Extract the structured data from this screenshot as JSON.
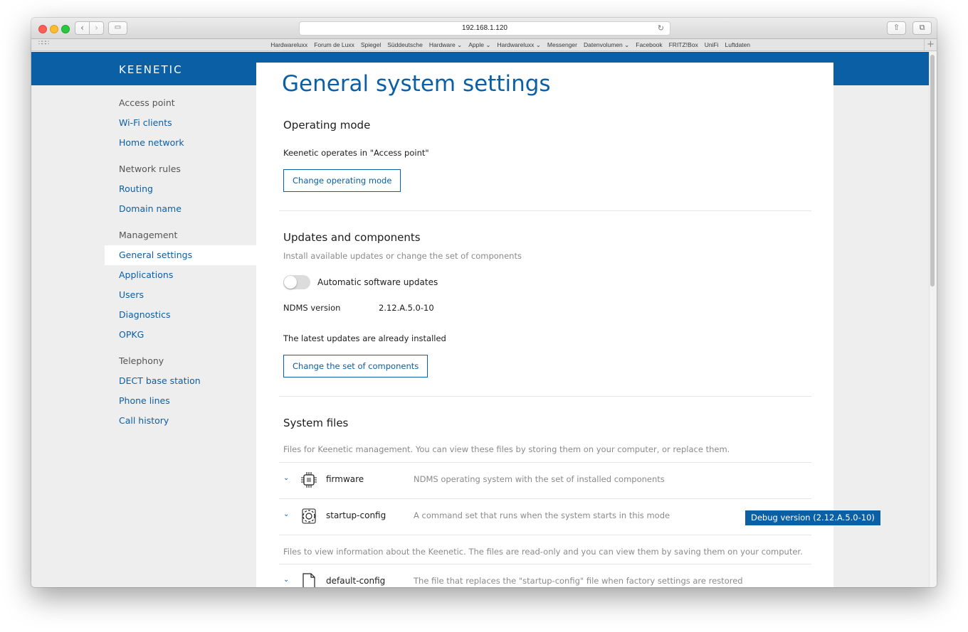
{
  "browser": {
    "address": "192.168.1.120",
    "favorites": [
      "Hardwareluxx",
      "Forum de Luxx",
      "Spiegel",
      "Süddeutsche",
      "Hardware ⌄",
      "Apple ⌄",
      "Hardwareluxx ⌄",
      "Messenger",
      "Datenvolumen ⌄",
      "Facebook",
      "FRITZ!Box",
      "UniFi",
      "Luftdaten"
    ]
  },
  "brand": {
    "logo": "KEENETIC",
    "accent": "#0b5fa5"
  },
  "sidebar": {
    "sections": [
      {
        "heading": "Access point",
        "items": [
          "Wi-Fi clients",
          "Home network"
        ]
      },
      {
        "heading": "Network rules",
        "items": [
          "Routing",
          "Domain name"
        ]
      },
      {
        "heading": "Management",
        "items": [
          "General settings",
          "Applications",
          "Users",
          "Diagnostics",
          "OPKG"
        ]
      },
      {
        "heading": "Telephony",
        "items": [
          "DECT base station",
          "Phone lines",
          "Call history"
        ]
      }
    ],
    "active": "General settings"
  },
  "main": {
    "title": "General system settings",
    "operating_mode": {
      "heading": "Operating mode",
      "text": "Keenetic operates in \"Access point\"",
      "button": "Change operating mode"
    },
    "updates": {
      "heading": "Updates and components",
      "subtitle": "Install available updates or change the set of components",
      "toggle_label": "Automatic software updates",
      "toggle_on": false,
      "version_label": "NDMS version",
      "version_value": "2.12.A.5.0-10",
      "status": "The latest updates are already installed",
      "button": "Change the set of components"
    },
    "system_files": {
      "heading": "System files",
      "subtitle": "Files for Keenetic management. You can view these files by storing them on your computer, or replace them.",
      "files": [
        {
          "name": "firmware",
          "desc": "NDMS operating system with the set of installed components",
          "icon": "chip-icon"
        },
        {
          "name": "startup-config",
          "desc": "A command set that runs when the system starts in this mode",
          "icon": "gear-icon"
        }
      ],
      "readonly_text": "Files to view information about the Keenetic. The files are read-only and you can view them by saving them on your computer.",
      "readonly_files": [
        {
          "name": "default-config",
          "desc": "The file that replaces the \"startup-config\" file when factory settings are restored",
          "icon": "file-icon"
        }
      ]
    }
  },
  "debug_badge": "Debug version (2.12.A.5.0-10)"
}
